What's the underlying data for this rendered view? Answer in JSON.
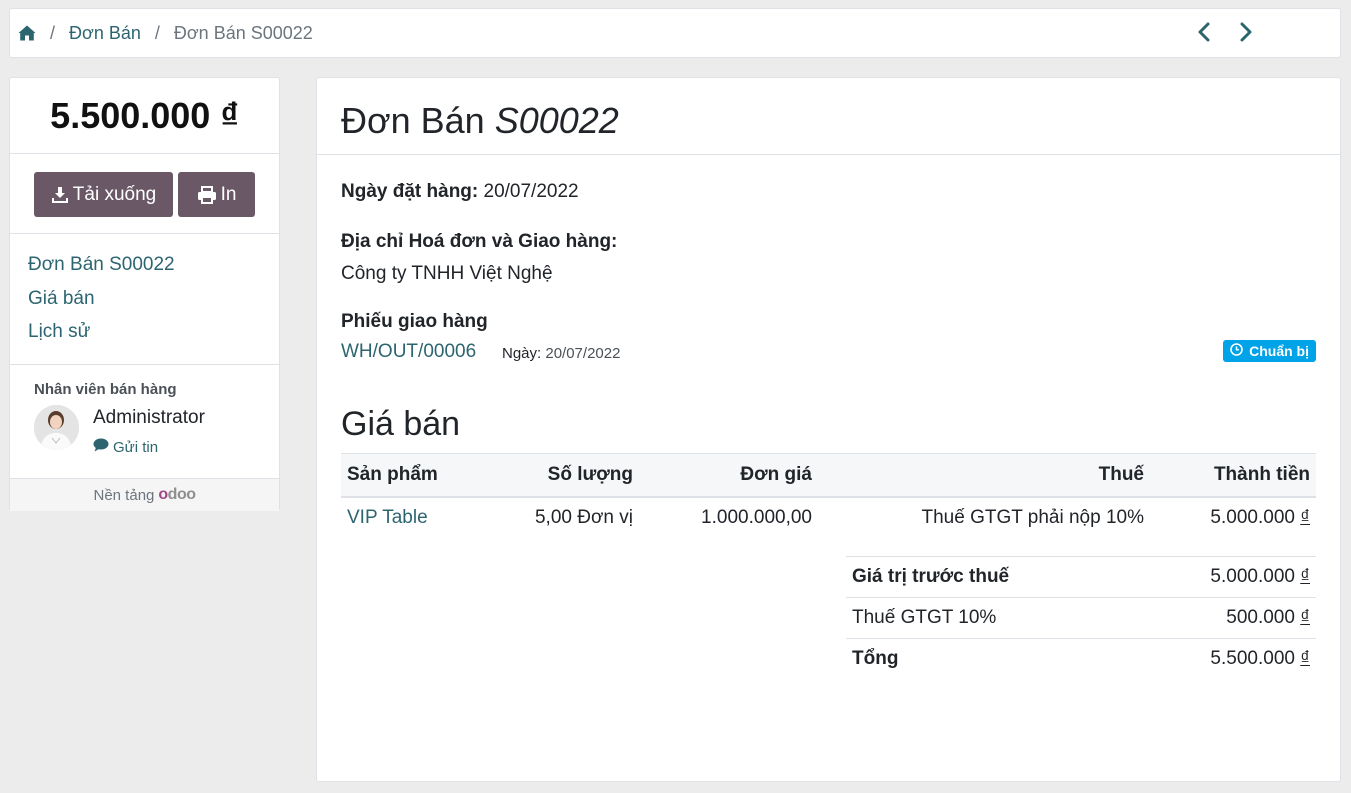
{
  "breadcrumb": {
    "items": [
      "Đơn Bán",
      "Đơn Bán S00022"
    ],
    "separator": "/"
  },
  "sidebar": {
    "amount": "5.500.000 ₫",
    "download_label": "Tải xuống",
    "print_label": "In",
    "nav": [
      "Đơn Bán S00022",
      "Giá bán",
      "Lịch sử"
    ],
    "salesperson_label": "Nhân viên bán hàng",
    "salesperson_name": "Administrator",
    "send_message_label": "Gửi tin",
    "powered_by": "Nền tảng",
    "brand": "odoo"
  },
  "order": {
    "title_prefix": "Đơn Bán",
    "title_number": "S00022",
    "order_date_label": "Ngày đặt hàng:",
    "order_date": "20/07/2022",
    "address_label": "Địa chỉ Hoá đơn và Giao hàng:",
    "address_value": "Công ty TNHH Việt Nghệ",
    "picking_label": "Phiếu giao hàng",
    "picking_ref": "WH/OUT/00006",
    "picking_date_label": "Ngày:",
    "picking_date": "20/07/2022",
    "picking_status": "Chuẩn bị"
  },
  "pricing": {
    "section_title": "Giá bán",
    "columns": [
      "Sản phẩm",
      "Số lượng",
      "Đơn giá",
      "Thuế",
      "Thành tiền"
    ],
    "lines": [
      {
        "product": "VIP Table",
        "qty": "5,00 Đơn vị",
        "unit_price": "1.000.000,00",
        "tax": "Thuế GTGT phải nộp 10%",
        "subtotal_amount": "5.000.000",
        "currency": "₫"
      }
    ],
    "totals": [
      {
        "label": "Giá trị trước thuế",
        "amount": "5.000.000",
        "currency": "₫"
      },
      {
        "label": "Thuế GTGT 10%",
        "amount": "500.000",
        "currency": "₫"
      },
      {
        "label": "Tổng",
        "amount": "5.500.000",
        "currency": "₫"
      }
    ]
  },
  "colors": {
    "link": "#2c6570",
    "button": "#6b5866",
    "badge": "#00a2e8",
    "odoo_purple": "#a24689"
  }
}
